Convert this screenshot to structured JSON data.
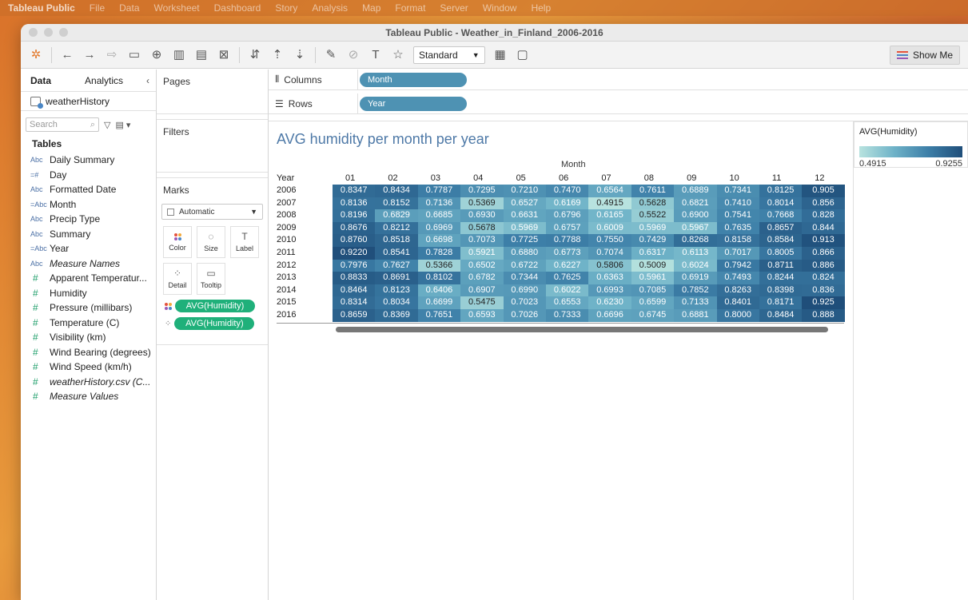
{
  "menubar": {
    "app": "Tableau Public",
    "items": [
      "File",
      "Data",
      "Worksheet",
      "Dashboard",
      "Story",
      "Analysis",
      "Map",
      "Format",
      "Server",
      "Window",
      "Help"
    ]
  },
  "window": {
    "title": "Tableau Public - Weather_in_Finland_2006-2016"
  },
  "toolbar": {
    "fit_select": "Standard",
    "show_me": "Show Me"
  },
  "data_pane": {
    "tab_data": "Data",
    "tab_analytics": "Analytics",
    "datasource": "weatherHistory",
    "search_placeholder": "Search",
    "tables_header": "Tables",
    "fields": [
      {
        "icon": "Abc",
        "label": "Daily Summary",
        "type": "dim",
        "italic": false
      },
      {
        "icon": "=#",
        "label": "Day",
        "type": "dim",
        "italic": false
      },
      {
        "icon": "Abc",
        "label": "Formatted Date",
        "type": "dim",
        "italic": false
      },
      {
        "icon": "=Abc",
        "label": "Month",
        "type": "dim",
        "italic": false
      },
      {
        "icon": "Abc",
        "label": "Precip Type",
        "type": "dim",
        "italic": false
      },
      {
        "icon": "Abc",
        "label": "Summary",
        "type": "dim",
        "italic": false
      },
      {
        "icon": "=Abc",
        "label": "Year",
        "type": "dim",
        "italic": false
      },
      {
        "icon": "Abc",
        "label": "Measure Names",
        "type": "dim",
        "italic": true
      },
      {
        "icon": "#",
        "label": "Apparent Temperatur...",
        "type": "meas",
        "italic": false
      },
      {
        "icon": "#",
        "label": "Humidity",
        "type": "meas",
        "italic": false
      },
      {
        "icon": "#",
        "label": "Pressure (millibars)",
        "type": "meas",
        "italic": false
      },
      {
        "icon": "#",
        "label": "Temperature (C)",
        "type": "meas",
        "italic": false
      },
      {
        "icon": "#",
        "label": "Visibility (km)",
        "type": "meas",
        "italic": false
      },
      {
        "icon": "#",
        "label": "Wind Bearing (degrees)",
        "type": "meas",
        "italic": false
      },
      {
        "icon": "#",
        "label": "Wind Speed (km/h)",
        "type": "meas",
        "italic": false
      },
      {
        "icon": "#",
        "label": "weatherHistory.csv (C...",
        "type": "meas",
        "italic": true
      },
      {
        "icon": "#",
        "label": "Measure Values",
        "type": "meas",
        "italic": true
      }
    ]
  },
  "cards": {
    "pages": "Pages",
    "filters": "Filters",
    "marks": "Marks",
    "mark_type": "Automatic",
    "color": "Color",
    "size": "Size",
    "label": "Label",
    "detail": "Detail",
    "tooltip": "Tooltip",
    "pill1": "AVG(Humidity)",
    "pill2": "AVG(Humidity)"
  },
  "shelves": {
    "columns_label": "Columns",
    "columns_pill": "Month",
    "rows_label": "Rows",
    "rows_pill": "Year"
  },
  "sheet": {
    "title": "AVG humidity per month per year",
    "col_header": "Month",
    "row_header": "Year"
  },
  "legend": {
    "title": "AVG(Humidity)",
    "min": "0.4915",
    "max": "0.9255"
  },
  "colors": {
    "low": "#b8e3df",
    "high": "#1f4e7a",
    "pill_blue": "#4e92b3",
    "pill_green": "#1fb07a"
  },
  "chart_data": {
    "type": "heatmap",
    "title": "AVG humidity per month per year",
    "xlabel": "Month",
    "ylabel": "Year",
    "x": [
      "01",
      "02",
      "03",
      "04",
      "05",
      "06",
      "07",
      "08",
      "09",
      "10",
      "11",
      "12"
    ],
    "y": [
      "2006",
      "2007",
      "2008",
      "2009",
      "2010",
      "2011",
      "2012",
      "2013",
      "2014",
      "2015",
      "2016"
    ],
    "display_values": [
      [
        "0.8347",
        "0.8434",
        "0.7787",
        "0.7295",
        "0.7210",
        "0.7470",
        "0.6564",
        "0.7611",
        "0.6889",
        "0.7341",
        "0.8125",
        "0.905"
      ],
      [
        "0.8136",
        "0.8152",
        "0.7136",
        "0.5369",
        "0.6527",
        "0.6169",
        "0.4915",
        "0.5628",
        "0.6821",
        "0.7410",
        "0.8014",
        "0.856"
      ],
      [
        "0.8196",
        "0.6829",
        "0.6685",
        "0.6930",
        "0.6631",
        "0.6796",
        "0.6165",
        "0.5522",
        "0.6900",
        "0.7541",
        "0.7668",
        "0.828"
      ],
      [
        "0.8676",
        "0.8212",
        "0.6969",
        "0.5678",
        "0.5969",
        "0.6757",
        "0.6009",
        "0.5969",
        "0.5967",
        "0.7635",
        "0.8657",
        "0.844"
      ],
      [
        "0.8760",
        "0.8518",
        "0.6698",
        "0.7073",
        "0.7725",
        "0.7788",
        "0.7550",
        "0.7429",
        "0.8268",
        "0.8158",
        "0.8584",
        "0.913"
      ],
      [
        "0.9220",
        "0.8541",
        "0.7828",
        "0.5921",
        "0.6880",
        "0.6773",
        "0.7074",
        "0.6317",
        "0.6113",
        "0.7017",
        "0.8005",
        "0.866"
      ],
      [
        "0.7976",
        "0.7627",
        "0.5366",
        "0.6502",
        "0.6722",
        "0.6227",
        "0.5806",
        "0.5009",
        "0.6024",
        "0.7942",
        "0.8711",
        "0.886"
      ],
      [
        "0.8833",
        "0.8691",
        "0.8102",
        "0.6782",
        "0.7344",
        "0.7625",
        "0.6363",
        "0.5961",
        "0.6919",
        "0.7493",
        "0.8244",
        "0.824"
      ],
      [
        "0.8464",
        "0.8123",
        "0.6406",
        "0.6907",
        "0.6990",
        "0.6022",
        "0.6993",
        "0.7085",
        "0.7852",
        "0.8263",
        "0.8398",
        "0.836"
      ],
      [
        "0.8314",
        "0.8034",
        "0.6699",
        "0.5475",
        "0.7023",
        "0.6553",
        "0.6230",
        "0.6599",
        "0.7133",
        "0.8401",
        "0.8171",
        "0.925"
      ],
      [
        "0.8659",
        "0.8369",
        "0.7651",
        "0.6593",
        "0.7026",
        "0.7333",
        "0.6696",
        "0.6745",
        "0.6881",
        "0.8000",
        "0.8484",
        "0.888"
      ]
    ],
    "color_range": [
      0.4915,
      0.9255
    ]
  }
}
